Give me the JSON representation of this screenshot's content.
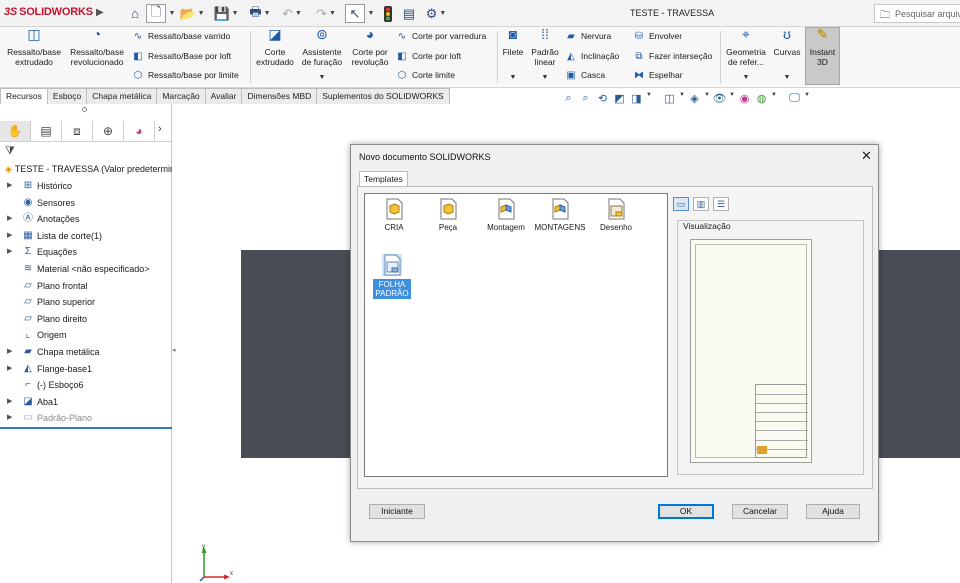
{
  "app": {
    "logo_ds": "3S",
    "logo_text": "SOLIDWORKS",
    "document_title": "TESTE - TRAVESSA",
    "search_placeholder": "Pesquisar arquivos"
  },
  "ribbon": {
    "big_buttons": [
      {
        "icon": "extruded-boss-icon",
        "label_1": "Ressalto/base",
        "label_2": "extrudado"
      },
      {
        "icon": "revolved-boss-icon",
        "label_1": "Ressalto/base",
        "label_2": "revolucionado"
      },
      {
        "icon": "extruded-cut-icon",
        "label_1": "Corte",
        "label_2": "extrudado"
      },
      {
        "icon": "hole-wizard-icon",
        "label_1": "Assistente",
        "label_2": "de furação"
      },
      {
        "icon": "revolved-cut-icon",
        "label_1": "Corte por",
        "label_2": "revolução"
      },
      {
        "icon": "fillet-icon",
        "label_1": "Filete",
        "label_2": ""
      },
      {
        "icon": "linear-pattern-icon",
        "label_1": "Padrão",
        "label_2": "linear"
      },
      {
        "icon": "reference-geometry-icon",
        "label_1": "Geometria",
        "label_2": "de refer..."
      },
      {
        "icon": "curves-icon",
        "label_1": "Curvas",
        "label_2": ""
      },
      {
        "icon": "instant3d-icon",
        "label_1": "Instant",
        "label_2": "3D"
      }
    ],
    "small_buttons": [
      {
        "icon": "swept-boss-icon",
        "label": "Ressalto/base varrido"
      },
      {
        "icon": "lofted-boss-icon",
        "label": "Ressalto/Base por loft"
      },
      {
        "icon": "boundary-boss-icon",
        "label": "Ressalto/base por limite"
      },
      {
        "icon": "swept-cut-icon",
        "label": "Corte por varredura"
      },
      {
        "icon": "lofted-cut-icon",
        "label": "Corte por loft"
      },
      {
        "icon": "boundary-cut-icon",
        "label": "Corte limite"
      },
      {
        "icon": "rib-icon",
        "label": "Nervura"
      },
      {
        "icon": "draft-icon",
        "label": "Inclinação"
      },
      {
        "icon": "shell-icon",
        "label": "Casca"
      },
      {
        "icon": "wrap-icon",
        "label": "Envolver"
      },
      {
        "icon": "intersect-icon",
        "label": "Fazer interseção"
      },
      {
        "icon": "mirror-icon",
        "label": "Espelhar"
      }
    ]
  },
  "tabs": [
    "Recursos",
    "Esboço",
    "Chapa metálica",
    "Marcação",
    "Avaliar",
    "Dimensões MBD",
    "Suplementos do SOLIDWORKS"
  ],
  "feature_tree": {
    "root": "TESTE - TRAVESSA  (Valor predeterminado)",
    "items": [
      {
        "label": "Histórico",
        "icon": "history-icon",
        "expandable": true
      },
      {
        "label": "Sensores",
        "icon": "sensors-icon",
        "expandable": false
      },
      {
        "label": "Anotações",
        "icon": "annotations-icon",
        "expandable": true
      },
      {
        "label": "Lista de corte(1)",
        "icon": "cut-list-icon",
        "expandable": true
      },
      {
        "label": "Equações",
        "icon": "equations-icon",
        "expandable": true
      },
      {
        "label": "Material <não especificado>",
        "icon": "material-icon",
        "expandable": false
      },
      {
        "label": "Plano frontal",
        "icon": "plane-icon",
        "expandable": false
      },
      {
        "label": "Plano superior",
        "icon": "plane-icon",
        "expandable": false
      },
      {
        "label": "Plano direito",
        "icon": "plane-icon",
        "expandable": false
      },
      {
        "label": "Origem",
        "icon": "origin-icon",
        "expandable": false
      },
      {
        "label": "Chapa metálica",
        "icon": "sheet-metal-icon",
        "expandable": true
      },
      {
        "label": "Flange-base1",
        "icon": "base-flange-icon",
        "expandable": true
      },
      {
        "label": "(-) Esboço6",
        "icon": "sketch-icon",
        "expandable": false
      },
      {
        "label": "Aba1",
        "icon": "edge-flange-icon",
        "expandable": true
      },
      {
        "label": "Padrão-Plano",
        "icon": "flat-pattern-icon",
        "expandable": true,
        "dim": true
      }
    ]
  },
  "dialog": {
    "title": "Novo documento SOLIDWORKS",
    "tab": "Templates",
    "templates": [
      {
        "label": "CRIA",
        "kind": "part"
      },
      {
        "label": "Peça",
        "kind": "part"
      },
      {
        "label": "Montagem",
        "kind": "assembly"
      },
      {
        "label": "MONTAGENS",
        "kind": "assembly"
      },
      {
        "label": "Desenho",
        "kind": "drawing"
      },
      {
        "label_1": "FOLHA",
        "label_2": "PADRÃO",
        "kind": "drawing",
        "selected": true
      }
    ],
    "preview_label": "Visualização",
    "buttons": {
      "novice": "Iniciante",
      "ok": "OK",
      "cancel": "Cancelar",
      "help": "Ajuda"
    }
  },
  "triad": {
    "x_label": "x",
    "y_label": "y"
  },
  "colors": {
    "brand": "#c8102e",
    "accent": "#1e5aa8",
    "selection": "#3d8fe0",
    "part": "#4a4d55"
  }
}
